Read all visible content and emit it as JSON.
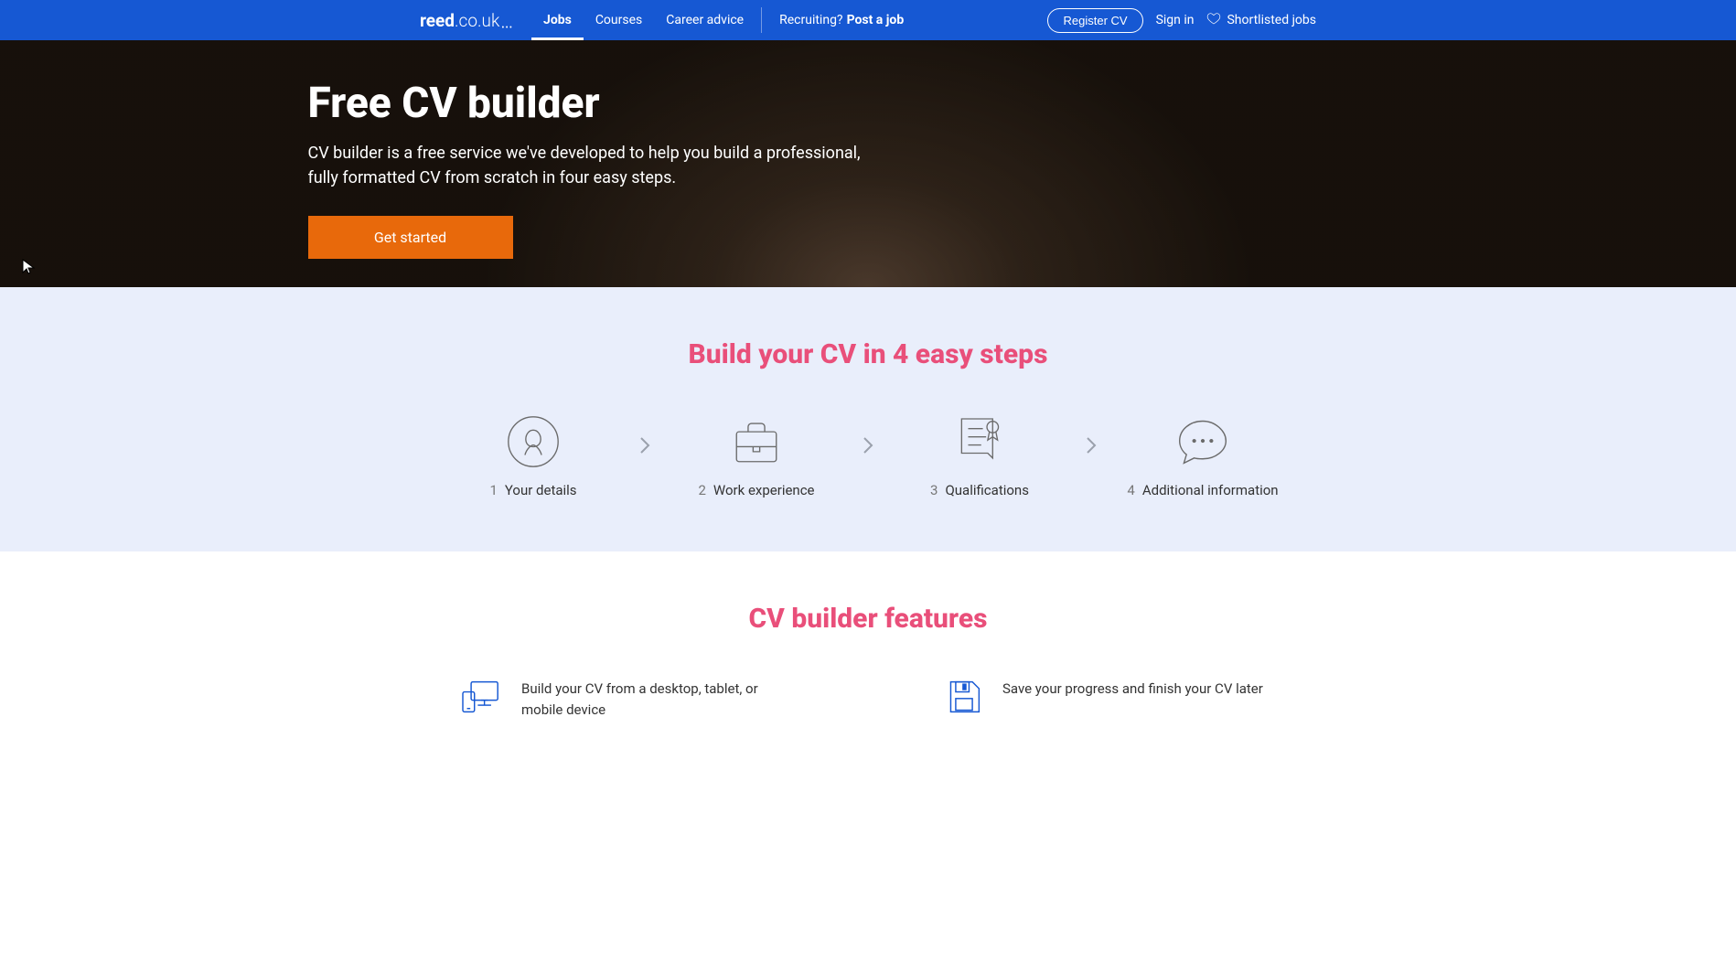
{
  "nav": {
    "logo_bold": "reed",
    "logo_light": ".co.uk",
    "items": [
      {
        "label": "Jobs",
        "active": true
      },
      {
        "label": "Courses",
        "active": false
      },
      {
        "label": "Career advice",
        "active": false
      }
    ],
    "recruiting_prefix": "Recruiting?",
    "recruiting_bold": "Post a job",
    "register_cv": "Register CV",
    "sign_in": "Sign in",
    "shortlisted": "Shortlisted jobs"
  },
  "hero": {
    "title": "Free CV builder",
    "subtitle": "CV builder is a free service we've developed to help you build a professional, fully formatted CV from scratch in four easy steps.",
    "cta": "Get started"
  },
  "steps": {
    "title": "Build your CV in 4 easy steps",
    "items": [
      {
        "num": "1",
        "label": "Your details"
      },
      {
        "num": "2",
        "label": "Work experience"
      },
      {
        "num": "3",
        "label": "Qualifications"
      },
      {
        "num": "4",
        "label": "Additional information"
      }
    ]
  },
  "features": {
    "title": "CV builder features",
    "items": [
      {
        "text": "Build your CV from a desktop, tablet, or mobile device"
      },
      {
        "text": "Save your progress and finish your CV later"
      }
    ]
  }
}
